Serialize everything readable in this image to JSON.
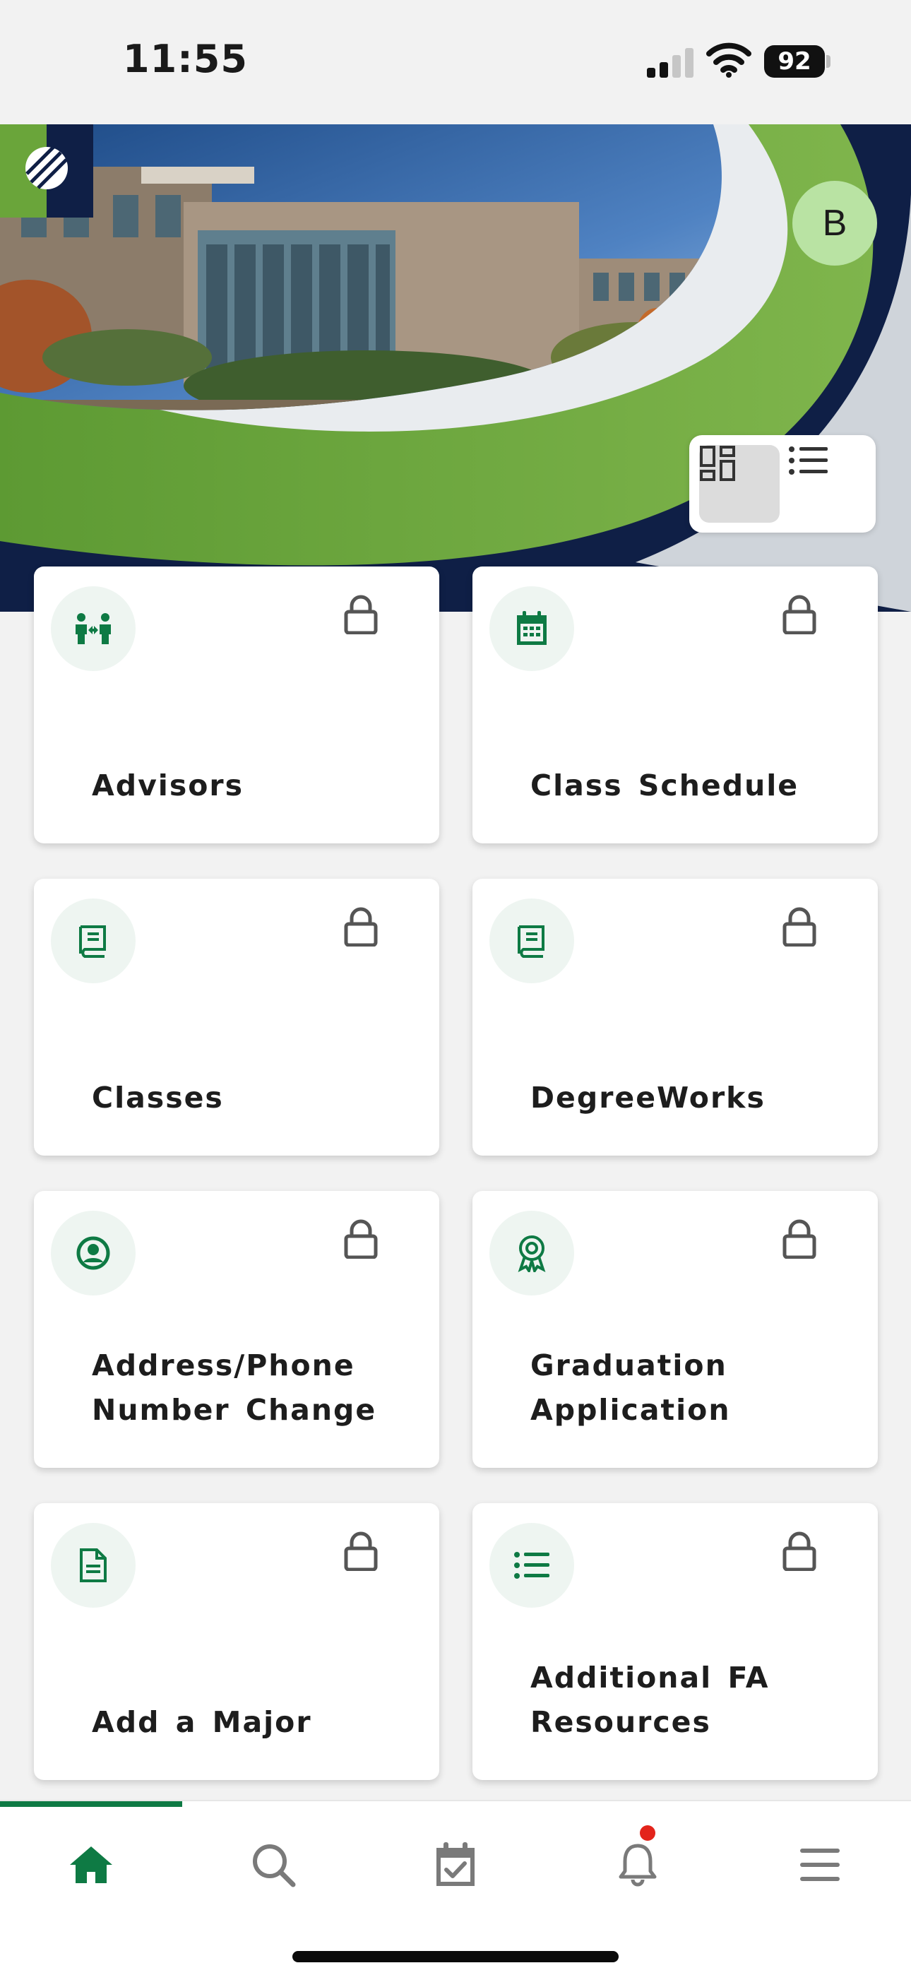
{
  "status_bar": {
    "time": "11:55",
    "battery": "92",
    "icons": [
      "signal-icon",
      "wifi-icon",
      "battery-icon"
    ]
  },
  "header": {
    "avatar_initial": "B",
    "logo": "college-logo",
    "colors": {
      "brand_green": "#0e7a44",
      "hero_green": "#6aa53a",
      "navy": "#0f1f46"
    }
  },
  "view_toggle": {
    "options": [
      "grid-view-icon",
      "list-view-icon"
    ],
    "selected": "grid"
  },
  "tiles": [
    {
      "label": "Advisors",
      "icon": "advisors-icon",
      "locked": true
    },
    {
      "label": "Class Schedule",
      "icon": "calendar-icon",
      "locked": true
    },
    {
      "label": "Classes",
      "icon": "book-icon",
      "locked": true
    },
    {
      "label": "DegreeWorks",
      "icon": "book-icon",
      "locked": true
    },
    {
      "label": "Address/Phone Number Change",
      "icon": "user-circle-icon",
      "locked": true
    },
    {
      "label": "Graduation Application",
      "icon": "award-icon",
      "locked": true
    },
    {
      "label": "Add a Major",
      "icon": "document-icon",
      "locked": true
    },
    {
      "label": "Additional FA Resources",
      "icon": "list-icon",
      "locked": true
    }
  ],
  "tab_bar": {
    "tabs": [
      {
        "icon": "home-icon",
        "active": true
      },
      {
        "icon": "search-icon",
        "active": false
      },
      {
        "icon": "calendar-check-icon",
        "active": false
      },
      {
        "icon": "bell-icon",
        "active": false,
        "notification": true
      },
      {
        "icon": "menu-icon",
        "active": false
      }
    ]
  }
}
